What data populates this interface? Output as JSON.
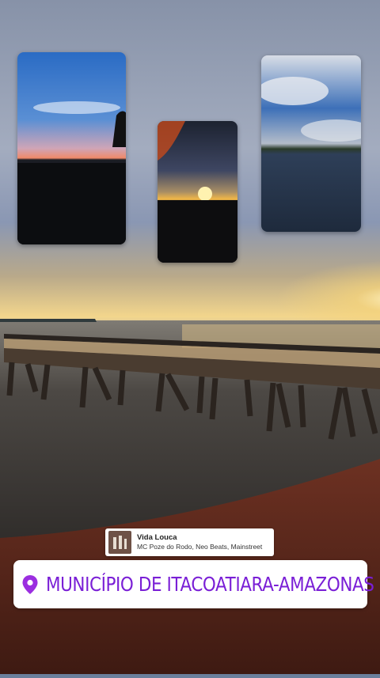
{
  "background": {
    "icon": "sunset-pier-photo",
    "colors": {
      "sky_top": "#7d8aa6",
      "sun": "#fde9a0",
      "water": "#3a3734",
      "sand": "#5a2a1c"
    }
  },
  "photos": [
    {
      "icon": "sunset-riverbank-photo"
    },
    {
      "icon": "sun-over-pier-photo"
    },
    {
      "icon": "cloudy-river-photo"
    }
  ],
  "music_sticker": {
    "icon": "album-cover",
    "title": "Vida Louca",
    "artists": "MC Poze do Rodo, Neo Beats, Mainstreet"
  },
  "location_sticker": {
    "icon": "location-pin-icon",
    "label": "MUNICÍPIO DE ITACOATIARA-AMAZONAS",
    "accent": "#7a1fd6"
  }
}
